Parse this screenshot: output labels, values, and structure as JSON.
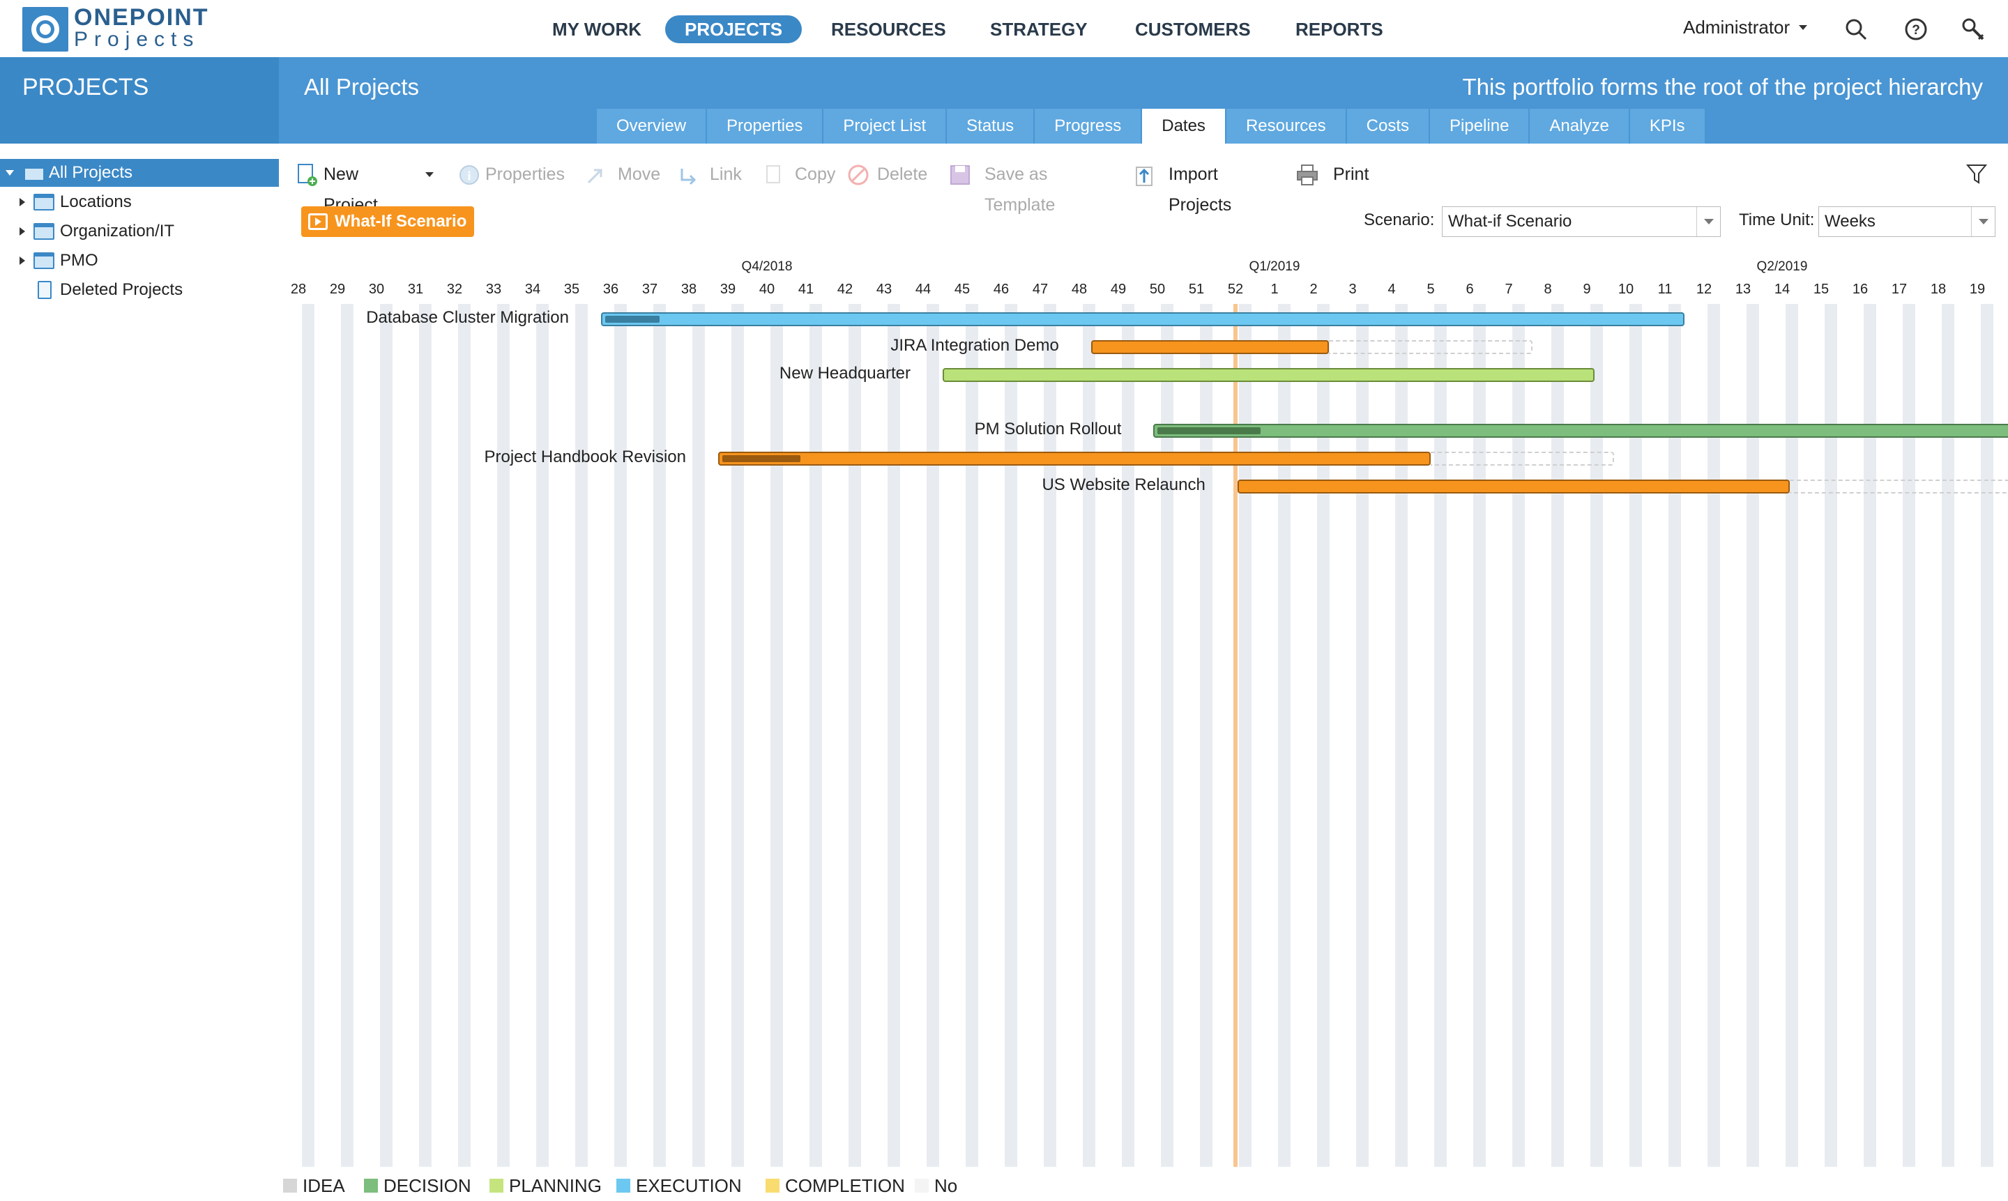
{
  "brand": {
    "line1": "ONEPOINT",
    "line2": "Projects"
  },
  "nav": {
    "items": [
      {
        "label": "MY WORK"
      },
      {
        "label": "PROJECTS",
        "active": true
      },
      {
        "label": "RESOURCES"
      },
      {
        "label": "STRATEGY"
      },
      {
        "label": "CUSTOMERS"
      },
      {
        "label": "REPORTS"
      }
    ],
    "user": "Administrator",
    "icons": [
      "search-icon",
      "help-icon",
      "tools-icon"
    ]
  },
  "module_title": "PROJECTS",
  "header": {
    "title": "All Projects",
    "description": "This portfolio forms the root of the project hierarchy"
  },
  "tabs": [
    {
      "label": "Overview"
    },
    {
      "label": "Properties"
    },
    {
      "label": "Project List"
    },
    {
      "label": "Status"
    },
    {
      "label": "Progress"
    },
    {
      "label": "Dates",
      "active": true
    },
    {
      "label": "Resources"
    },
    {
      "label": "Costs"
    },
    {
      "label": "Pipeline"
    },
    {
      "label": "Analyze"
    },
    {
      "label": "KPIs"
    }
  ],
  "tree": [
    {
      "label": "All Projects",
      "selected": true,
      "expanded": true,
      "icon": "portfolio-icon"
    },
    {
      "label": "Locations",
      "icon": "portfolio-icon"
    },
    {
      "label": "Organization/IT",
      "icon": "portfolio-icon"
    },
    {
      "label": "PMO",
      "icon": "portfolio-icon"
    },
    {
      "label": "Deleted Projects",
      "icon": "trash-icon"
    }
  ],
  "toolbar": {
    "new_project": "New Project",
    "properties": "Properties",
    "move": "Move",
    "link": "Link",
    "copy": "Copy",
    "delete": "Delete",
    "save_template": "Save as Template",
    "import": "Import Projects",
    "print": "Print"
  },
  "scenario_badge": "What-If Scenario",
  "scenario": {
    "label": "Scenario:",
    "value": "What-if Scenario"
  },
  "time_unit": {
    "label": "Time Unit:",
    "value": "Weeks"
  },
  "timeline": {
    "weeks": [
      "28",
      "29",
      "30",
      "31",
      "32",
      "33",
      "34",
      "35",
      "36",
      "37",
      "38",
      "39",
      "40",
      "41",
      "42",
      "43",
      "44",
      "45",
      "46",
      "47",
      "48",
      "49",
      "50",
      "51",
      "52",
      "1",
      "2",
      "3",
      "4",
      "5",
      "6",
      "7",
      "8",
      "9",
      "10",
      "11",
      "12",
      "13",
      "14",
      "15",
      "16",
      "17",
      "18",
      "19"
    ],
    "quarters": [
      {
        "label": "Q4/2018",
        "week_index": 12
      },
      {
        "label": "Q1/2019",
        "week_index": 25
      },
      {
        "label": "Q2/2019",
        "week_index": 38
      }
    ],
    "today_week_index": 24
  },
  "projects": [
    {
      "name": "Database Cluster Migration",
      "status": "EXECUTION",
      "color": "#6cc8f0",
      "progress_color": "#3a7fa0",
      "start_week_index": 7.75,
      "end_week_index": 35.5,
      "progress_fraction": 0.05,
      "planned_end_week_index": null
    },
    {
      "name": "JIRA Integration Demo",
      "status": "COMPLETION",
      "color": "#f7941d",
      "progress_color": "#9a5a10",
      "start_week_index": 20.3,
      "end_week_index": 26.4,
      "progress_fraction": 0,
      "planned_end_week_index": 31.6
    },
    {
      "name": "New Headquarter",
      "status": "PLANNING",
      "color": "#b9e27a",
      "progress_color": "#6b8c3a",
      "start_week_index": 16.5,
      "end_week_index": 33.2,
      "progress_fraction": 0,
      "planned_end_week_index": null
    },
    {
      "name": "PM Solution Rollout",
      "status": "DECISION",
      "color": "#7dbd7d",
      "progress_color": "#4a7a4a",
      "start_week_index": 21.9,
      "end_week_index": 45,
      "progress_fraction": 0.12,
      "planned_end_week_index": null
    },
    {
      "name": "Project Handbook Revision",
      "status": "COMPLETION",
      "color": "#f7941d",
      "progress_color": "#9a5a10",
      "start_week_index": 10.75,
      "end_week_index": 29.0,
      "progress_fraction": 0.11,
      "planned_end_week_index": 33.7
    },
    {
      "name": "US Website Relaunch",
      "status": "COMPLETION",
      "color": "#f7941d",
      "progress_color": "#9a5a10",
      "start_week_index": 24.05,
      "end_week_index": 38.2,
      "progress_fraction": 0,
      "planned_end_week_index": 45
    }
  ],
  "legend": [
    {
      "label": "IDEA",
      "color": "#d6d6d6"
    },
    {
      "label": "DECISION",
      "color": "#7dbd7d"
    },
    {
      "label": "PLANNING",
      "color": "#c5e47e"
    },
    {
      "label": "EXECUTION",
      "color": "#6cc8f0"
    },
    {
      "label": "COMPLETION",
      "color": "#f9dc70"
    },
    {
      "label": "No Status",
      "color": "#f4f4f4"
    }
  ]
}
